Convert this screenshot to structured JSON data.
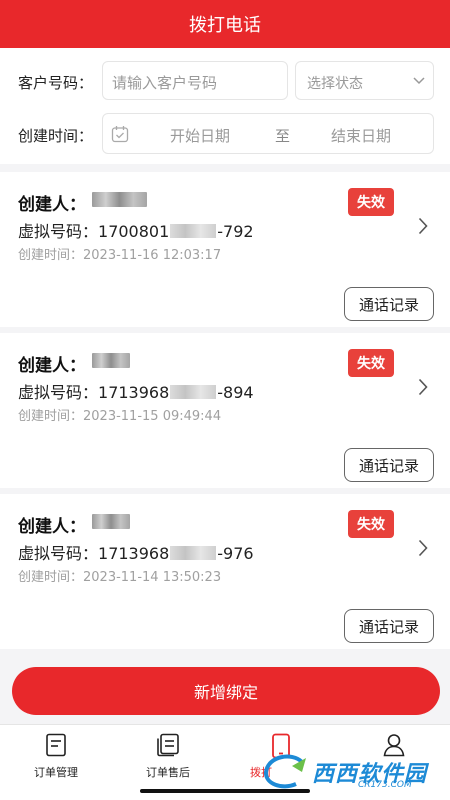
{
  "header": {
    "title": "拨打电话"
  },
  "filter": {
    "customer_label": "客户号码：",
    "customer_placeholder": "请输入客户号码",
    "status_placeholder": "选择状态",
    "time_label": "创建时间：",
    "start_date": "开始日期",
    "to_text": "至",
    "end_date": "结束日期"
  },
  "cards": [
    {
      "creator_label": "创建人：",
      "status": "失效",
      "phone_label": "虚拟号码：",
      "phone_prefix": "1700801",
      "phone_suffix": "-792",
      "time_label": "创建时间：",
      "time": "2023-11-16 12:03:17",
      "record_button": "通话记录"
    },
    {
      "creator_label": "创建人：",
      "status": "失效",
      "phone_label": "虚拟号码：",
      "phone_prefix": "1713968",
      "phone_suffix": "-894",
      "time_label": "创建时间：",
      "time": "2023-11-15 09:49:44",
      "record_button": "通话记录"
    },
    {
      "creator_label": "创建人：",
      "status": "失效",
      "phone_label": "虚拟号码：",
      "phone_prefix": "1713968",
      "phone_suffix": "-976",
      "time_label": "创建时间：",
      "time": "2023-11-14 13:50:23",
      "record_button": "通话记录"
    }
  ],
  "add_button": "新增绑定",
  "tabbar": {
    "items": [
      {
        "label": "订单管理",
        "icon": "document-icon"
      },
      {
        "label": "订单售后",
        "icon": "stack-document-icon"
      },
      {
        "label": "拨打",
        "icon": "phone-icon"
      },
      {
        "label": "",
        "icon": "user-icon"
      }
    ]
  },
  "watermark": {
    "text": "西西软件园",
    "sub": "CR173.COM"
  },
  "colors": {
    "brand": "#e8282b",
    "badge": "#e8413b",
    "watermark": "#1d8ad6"
  }
}
